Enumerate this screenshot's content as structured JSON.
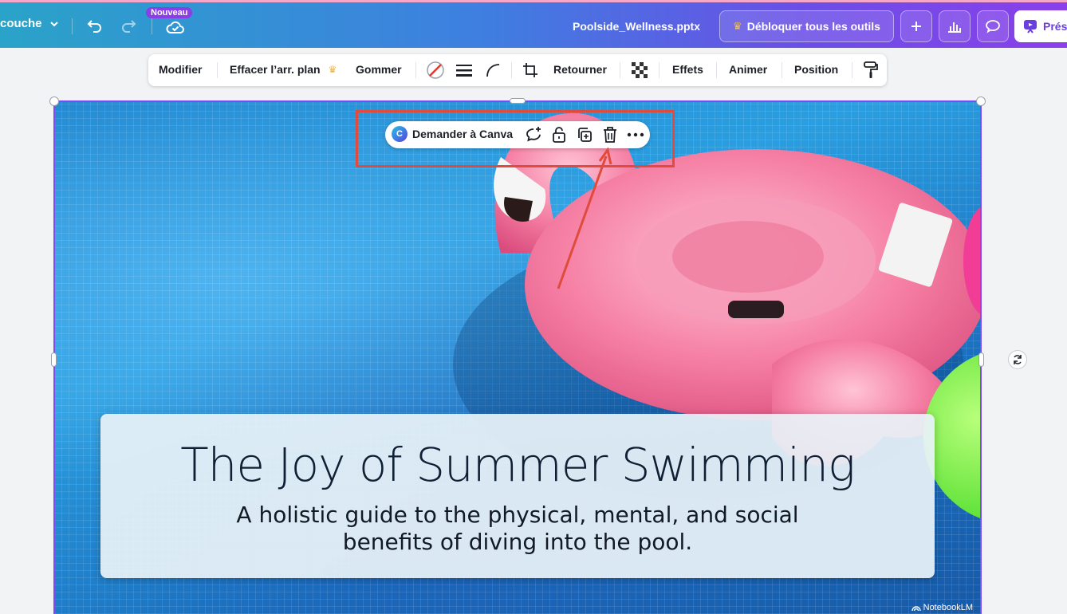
{
  "header": {
    "file_menu_label": "couche",
    "badge_new": "Nouveau",
    "document_title": "Poolside_Wellness.pptx",
    "unlock_label": "Débloquer tous les outils",
    "present_label": "Prés"
  },
  "context_toolbar": {
    "edit": "Modifier",
    "remove_bg": "Effacer l’arr. plan",
    "erase": "Gommer",
    "flip": "Retourner",
    "effects": "Effets",
    "animate": "Animer",
    "position": "Position"
  },
  "mini_toolbar": {
    "ask_canva": "Demander à Canva"
  },
  "slide": {
    "title": "The Joy of Summer Swimming",
    "subtitle_line1": "A holistic guide to the physical, mental, and social",
    "subtitle_line2": "benefits of diving into the pool.",
    "watermark": "NotebookLM"
  },
  "colors": {
    "selection": "#7d4cf0",
    "annotation": "#e04b3c",
    "accent": "#6a3fe0"
  },
  "icons": [
    "chevron-down-icon",
    "undo-icon",
    "redo-icon",
    "cloud-check-icon",
    "crown-icon",
    "plus-icon",
    "bar-chart-icon",
    "comment-icon",
    "present-icon",
    "color-slash-icon",
    "border-weight-icon",
    "corner-radius-icon",
    "crop-icon",
    "transparency-icon",
    "paint-roller-icon",
    "comment-plus-icon",
    "unlock-icon",
    "duplicate-icon",
    "trash-icon",
    "more-icon",
    "rotate-icon"
  ]
}
